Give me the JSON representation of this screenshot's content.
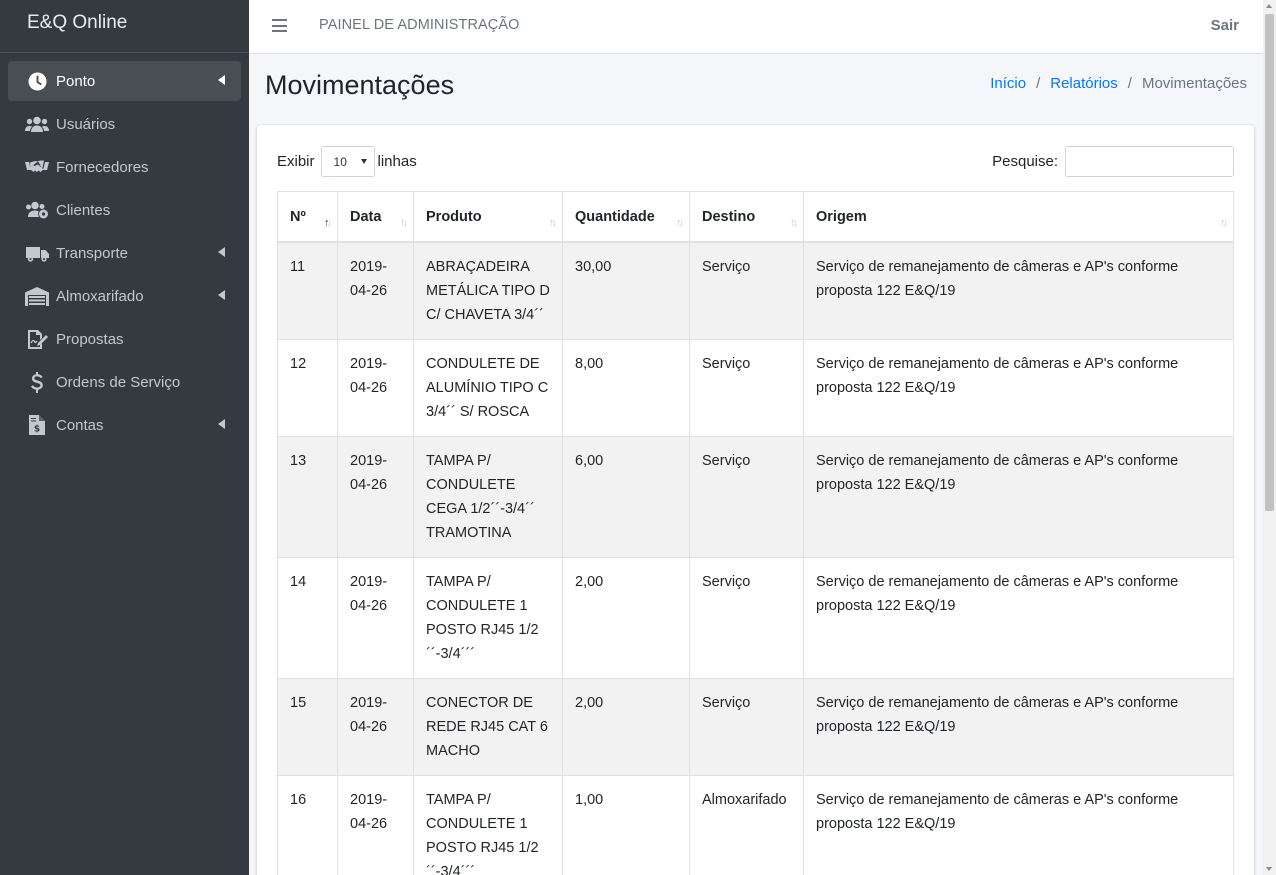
{
  "brand": "E&Q Online",
  "sidebar": {
    "items": [
      {
        "label": "Ponto",
        "icon": "clock-icon",
        "active": true,
        "has_arrow": true
      },
      {
        "label": "Usuários",
        "icon": "users-icon",
        "has_arrow": false
      },
      {
        "label": "Fornecedores",
        "icon": "handshake-icon",
        "has_arrow": false
      },
      {
        "label": "Clientes",
        "icon": "users-cog-icon",
        "has_arrow": false
      },
      {
        "label": "Transporte",
        "icon": "truck-icon",
        "has_arrow": true
      },
      {
        "label": "Almoxarifado",
        "icon": "warehouse-icon",
        "has_arrow": true
      },
      {
        "label": "Propostas",
        "icon": "signature-icon",
        "has_arrow": false
      },
      {
        "label": "Ordens de Serviço",
        "icon": "dollar-icon",
        "has_arrow": false
      },
      {
        "label": "Contas",
        "icon": "invoice-icon",
        "has_arrow": true
      }
    ]
  },
  "topbar": {
    "title": "PAINEL DE ADMINISTRAÇÃO",
    "logout": "Sair"
  },
  "page": {
    "title": "Movimentações",
    "breadcrumb": [
      "Início",
      "Relatórios",
      "Movimentações"
    ]
  },
  "table_controls": {
    "show_label": "Exibir",
    "page_size": "10",
    "rows_label": "linhas",
    "search_label": "Pesquise:",
    "search_value": ""
  },
  "table": {
    "headers": [
      "Nº",
      "Data",
      "Produto",
      "Quantidade",
      "Destino",
      "Origem"
    ],
    "sorted_column": 0,
    "rows": [
      {
        "n": "11",
        "data": "2019-04-26",
        "produto": "ABRAÇADEIRA METÁLICA TIPO D C/ CHAVETA 3/4´´",
        "quantidade": "30,00",
        "destino": "Serviço",
        "origem": "Serviço de remanejamento de câmeras e AP's conforme proposta 122 E&Q/19"
      },
      {
        "n": "12",
        "data": "2019-04-26",
        "produto": "CONDULETE DE ALUMÍNIO TIPO C 3/4´´ S/ ROSCA",
        "quantidade": "8,00",
        "destino": "Serviço",
        "origem": "Serviço de remanejamento de câmeras e AP's conforme proposta 122 E&Q/19"
      },
      {
        "n": "13",
        "data": "2019-04-26",
        "produto": "TAMPA P/ CONDULETE CEGA 1/2´´-3/4´´ TRAMOTINA",
        "quantidade": "6,00",
        "destino": "Serviço",
        "origem": "Serviço de remanejamento de câmeras e AP's conforme proposta 122 E&Q/19"
      },
      {
        "n": "14",
        "data": "2019-04-26",
        "produto": "TAMPA P/ CONDULETE 1 POSTO RJ45 1/2 ´´-3/4´´´",
        "quantidade": "2,00",
        "destino": "Serviço",
        "origem": "Serviço de remanejamento de câmeras e AP's conforme proposta 122 E&Q/19"
      },
      {
        "n": "15",
        "data": "2019-04-26",
        "produto": "CONECTOR DE REDE RJ45 CAT 6 MACHO",
        "quantidade": "2,00",
        "destino": "Serviço",
        "origem": "Serviço de remanejamento de câmeras e AP's conforme proposta 122 E&Q/19"
      },
      {
        "n": "16",
        "data": "2019-04-26",
        "produto": "TAMPA P/ CONDULETE 1 POSTO RJ45 1/2 ´´-3/4´´´",
        "quantidade": "1,00",
        "destino": "Almoxarifado",
        "origem": "Serviço de remanejamento de câmeras e AP's conforme proposta 122 E&Q/19"
      }
    ]
  }
}
